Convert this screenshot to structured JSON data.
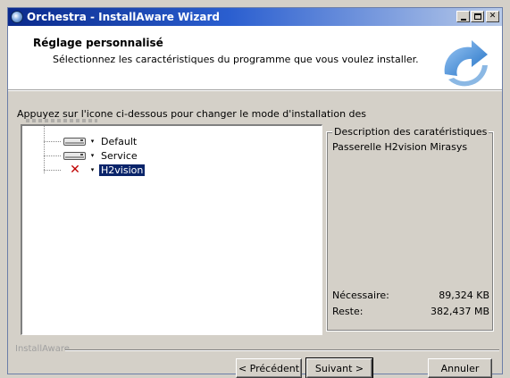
{
  "window": {
    "title": "Orchestra - InstallAware Wizard",
    "controls": {
      "minimize": "_",
      "maximize": "□",
      "close": "✕"
    }
  },
  "header": {
    "title": "Réglage personnalisé",
    "subtitle": "Sélectionnez les caractéristiques du programme que vous voulez installer."
  },
  "instruction": "Appuyez sur l'icone ci-dessous pour changer le mode d'installation des",
  "features": [
    {
      "label": "Default",
      "icon": "drive-icon",
      "selected": false
    },
    {
      "label": "Service",
      "icon": "drive-icon",
      "selected": false
    },
    {
      "label": "H2vision",
      "icon": "red-x-icon",
      "selected": true
    }
  ],
  "description": {
    "legend": "Description des caratéristiques",
    "text": "Passerelle H2vision Mirasys",
    "required_label": "Nécessaire:",
    "required_value": "89,324 KB",
    "remaining_label": "Reste:",
    "remaining_value": "382,437 MB"
  },
  "footer": {
    "brand": "InstallAware",
    "back": "< Précédent",
    "next": "Suivant >",
    "cancel": "Annuler"
  },
  "colors": {
    "titlebar_start": "#0a2a8c",
    "titlebar_end": "#b9cbe9",
    "selection": "#0a246a",
    "x_mark": "#c00000"
  }
}
